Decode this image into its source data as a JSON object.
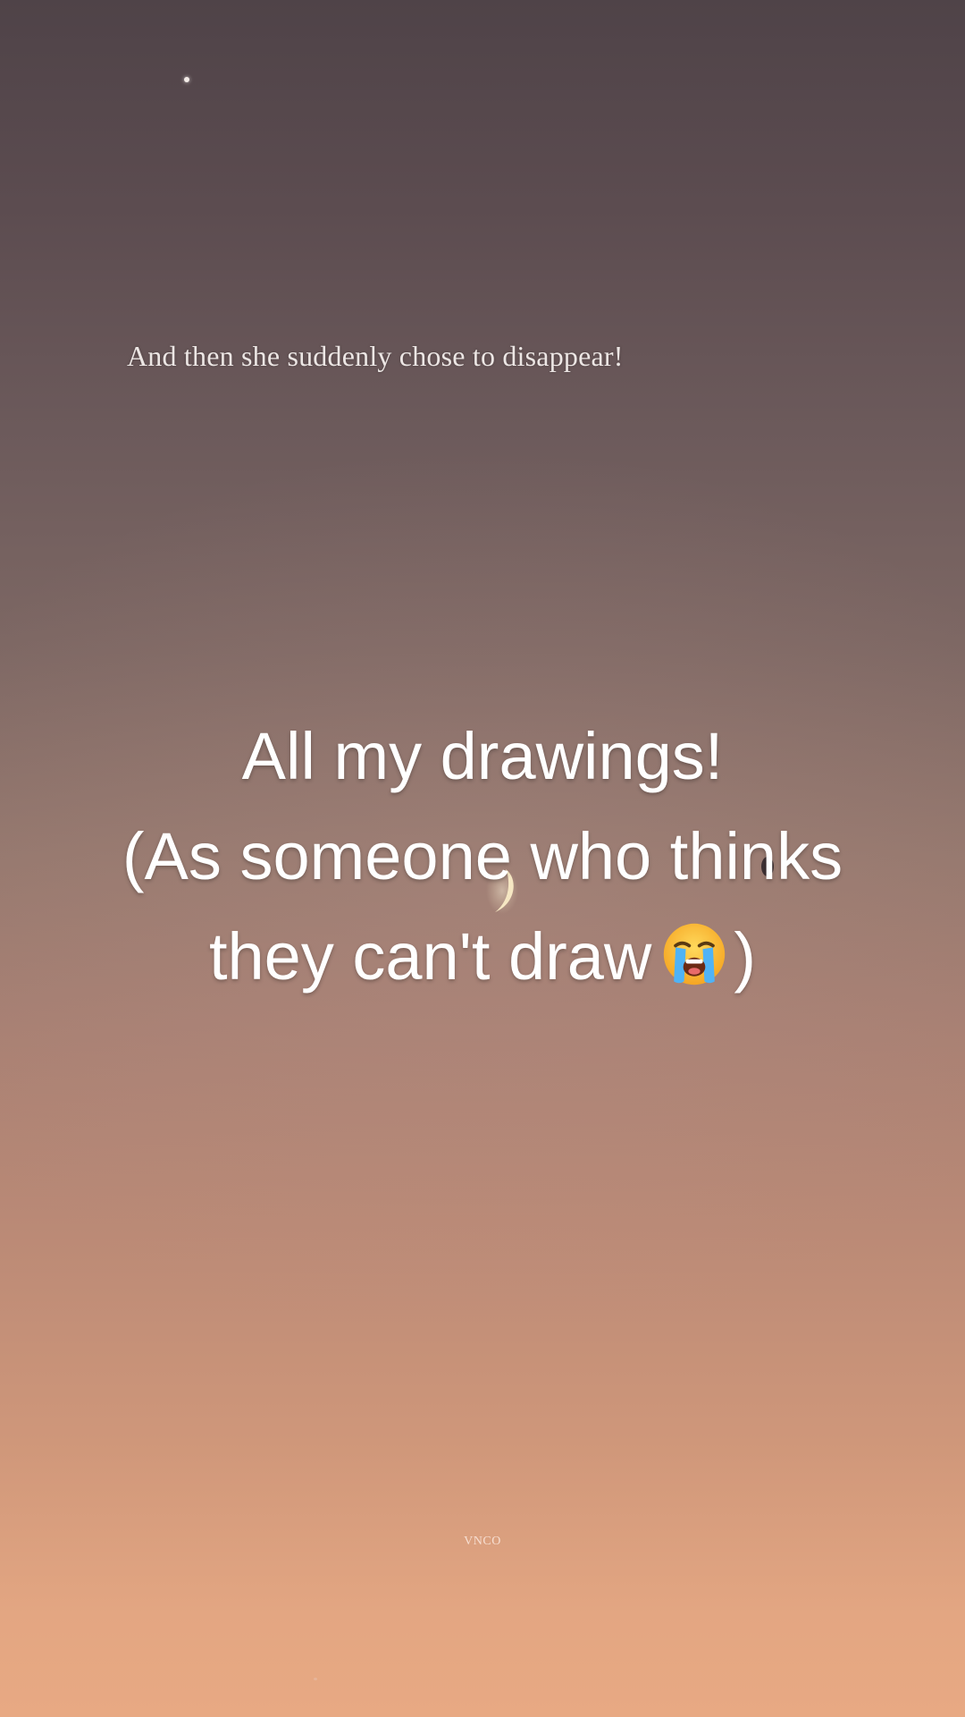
{
  "scene": {
    "caption": "And then she suddenly chose to disappear!",
    "watermark": "VNCO"
  },
  "overlay": {
    "line1": "All my drawings!",
    "line2": "(As someone who thinks",
    "line3_text": "they can't draw",
    "line3_close": ")",
    "emoji": "loudly-crying-face-icon"
  },
  "colors": {
    "sky_top": "#4f4348",
    "sky_bottom": "#e8a983",
    "text": "#ffffff",
    "moon": "#f6e7c3"
  }
}
